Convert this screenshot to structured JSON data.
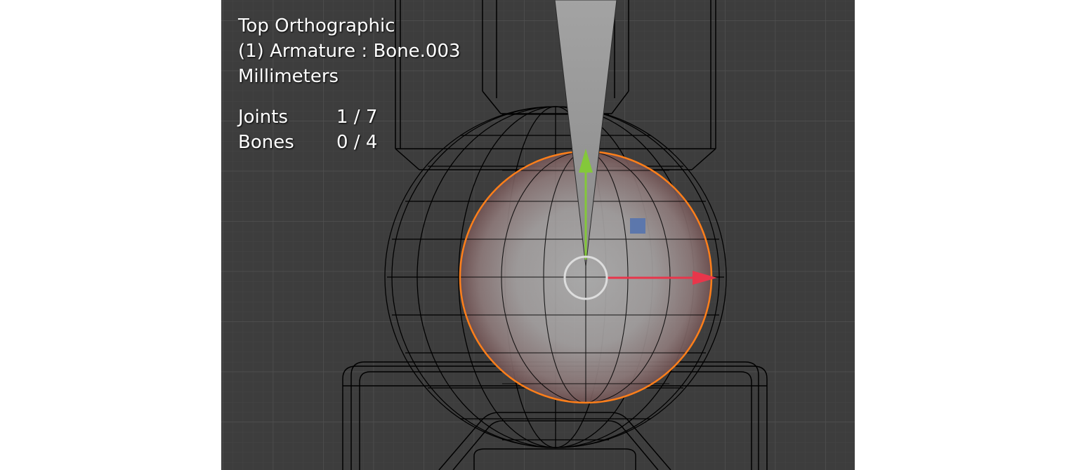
{
  "viewport": {
    "view_name": "Top Orthographic",
    "active_object": "(1) Armature : Bone.003",
    "units": "Millimeters",
    "background_color": "#3d3d3d"
  },
  "statistics": [
    {
      "label": "Joints",
      "value": "1 / 7"
    },
    {
      "label": "Bones",
      "value": "0 / 4"
    }
  ],
  "colors": {
    "selection_outline": "#ff7f1a",
    "x_axis_arrow": "#e8364b",
    "y_axis_arrow": "#84c83a",
    "gizmo_center": "#dddddd",
    "free_handle": "#5c77ac",
    "wire": "#000000"
  },
  "icons": {
    "center": "transform-center-circle-icon",
    "x_arrow": "x-axis-arrow-icon",
    "y_arrow": "y-axis-arrow-icon",
    "free_move": "free-move-square-icon"
  }
}
